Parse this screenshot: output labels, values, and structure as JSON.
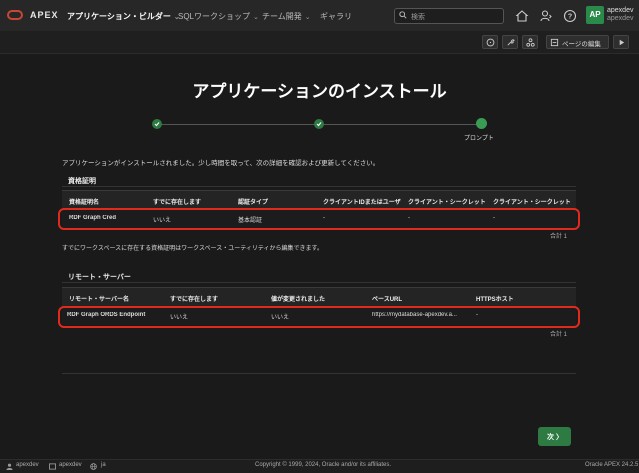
{
  "header": {
    "brand": "APEX",
    "nav": [
      {
        "label": "アプリケーション・ビルダー",
        "chevron": "⌄"
      },
      {
        "label": "SQLワークショップ",
        "chevron": "⌄"
      },
      {
        "label": "チーム開発",
        "chevron": "⌄"
      },
      {
        "label": "ギャラリ",
        "chevron": ""
      }
    ],
    "search_placeholder": "検索",
    "avatar_initials": "AP",
    "user_name": "apexdev",
    "user_workspace": "apexdev"
  },
  "toolbar": {
    "edit_page_label": "ページの編集"
  },
  "page": {
    "title": "アプリケーションのインストール"
  },
  "wizard": {
    "current_step_label": "プロンプト"
  },
  "message": "アプリケーションがインストールされました。少し時間を取って、次の詳細を確認および更新してください。",
  "credentials": {
    "title": "資格証明",
    "columns": [
      "資格証明名",
      "すでに存在します",
      "認証タイプ",
      "クライアントIDまたはユーザ",
      "クライアント・シークレット",
      "クライアント・シークレット"
    ],
    "rows": [
      [
        "RDF Graph Cred",
        "いいえ",
        "基本認証",
        "-",
        "-",
        "-"
      ]
    ],
    "total": "合計 1"
  },
  "info_note": "すでにワークスペースに存在する資格証明はワークスペース・ユーティリティから編集できます。",
  "remote_servers": {
    "title": "リモート・サーバー",
    "columns": [
      "リモート・サーバー名",
      "すでに存在します",
      "値が変更されました",
      "ベースURL",
      "HTTPSホスト"
    ],
    "rows": [
      [
        "RDF Graph ORDS Endpoint",
        "いいえ",
        "いいえ",
        "https://mydatabase-apexdev.a...",
        "-"
      ]
    ],
    "total": "合計 1"
  },
  "next_button": "次 〉",
  "footer": {
    "user": "apexdev",
    "workspace": "apexdev",
    "language": "ja",
    "copyright": "Copyright © 1999, 2024, Oracle and/or its affiliates.",
    "version": "Oracle APEX 24.2.5"
  },
  "colors": {
    "accent_green": "#2d7a43",
    "highlight_red": "#e02a1e",
    "brand_red": "#c74634"
  }
}
